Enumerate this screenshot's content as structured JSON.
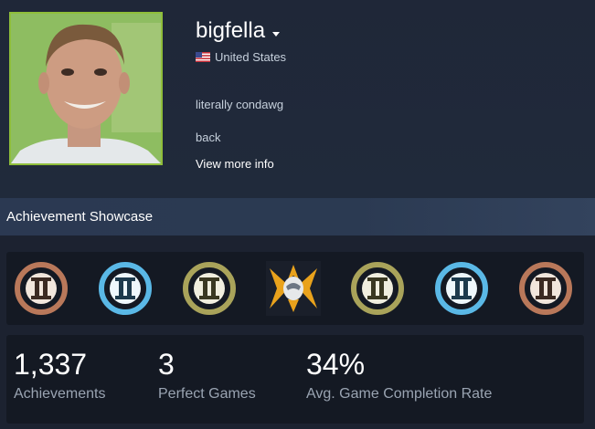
{
  "profile": {
    "name": "bigfella",
    "country": "United States",
    "summary_line1": "literally condawg",
    "summary_line2": "back",
    "view_more": "View more info"
  },
  "showcase": {
    "title": "Achievement Showcase",
    "achievements": [
      {
        "icon": "bronze-roman-two-icon",
        "color": "#b9785a"
      },
      {
        "icon": "blue-roman-two-icon",
        "color": "#5ab8e6"
      },
      {
        "icon": "olive-roman-two-icon",
        "color": "#a9a35a"
      },
      {
        "icon": "gold-halo-emblem-icon",
        "color": "#e9a21c"
      },
      {
        "icon": "olive-roman-two-icon",
        "color": "#a9a35a"
      },
      {
        "icon": "blue-roman-two-icon",
        "color": "#5ab8e6"
      },
      {
        "icon": "bronze-roman-two-icon",
        "color": "#b9785a"
      }
    ],
    "stats": {
      "achievements_value": "1,337",
      "achievements_label": "Achievements",
      "perfect_value": "3",
      "perfect_label": "Perfect Games",
      "completion_value": "34%",
      "completion_label": "Avg. Game Completion Rate"
    }
  }
}
